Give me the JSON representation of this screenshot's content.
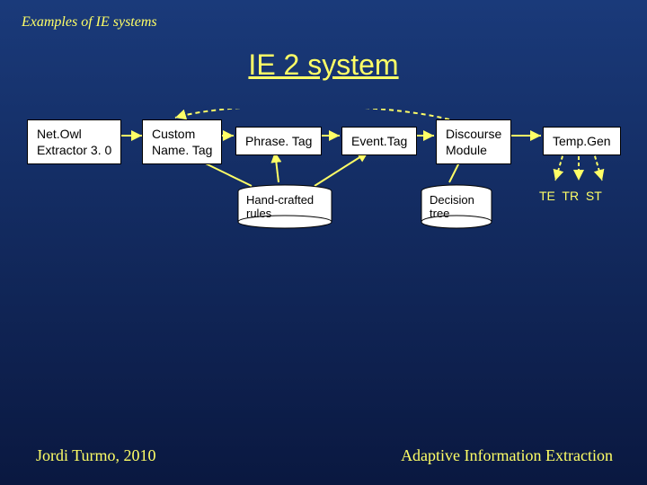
{
  "header": "Examples of IE systems",
  "title": "IE 2 system",
  "boxes": {
    "netowl": "Net.Owl\nExtractor 3. 0",
    "custom": "Custom\nName. Tag",
    "phrase": "Phrase. Tag",
    "event": "Event.Tag",
    "discourse": "Discourse\nModule",
    "tempgen": "Temp.Gen"
  },
  "labels": {
    "handcrafted": "Hand-crafted\nrules",
    "decision": "Decision\ntree",
    "outputs": "TE  TR  ST"
  },
  "footer": {
    "left": "Jordi Turmo, 2010",
    "right": "Adaptive Information Extraction"
  }
}
